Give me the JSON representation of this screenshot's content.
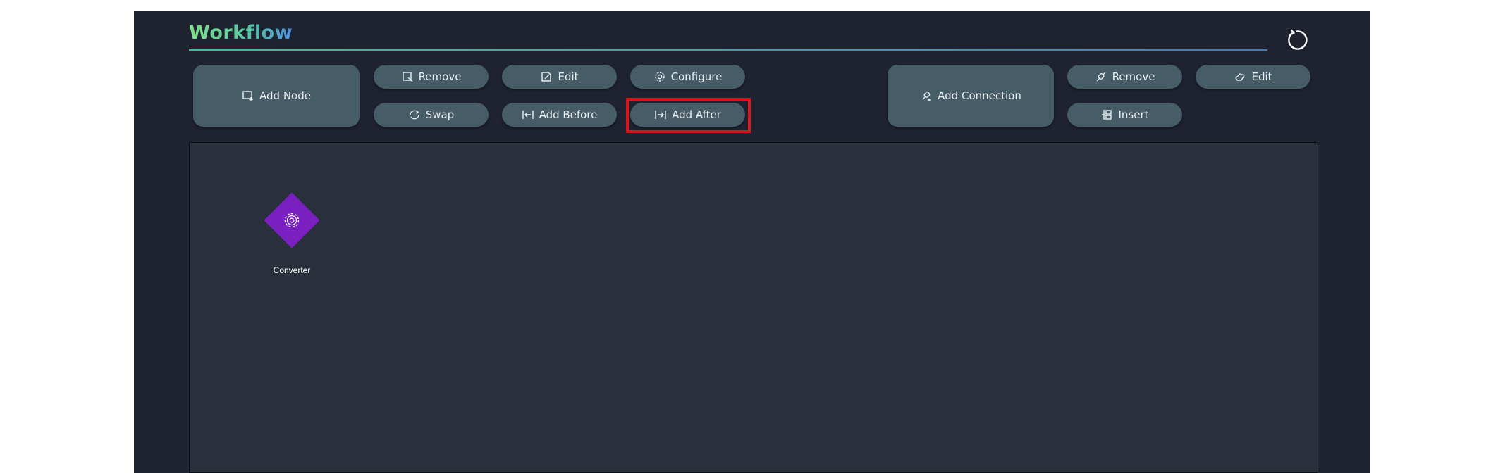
{
  "header": {
    "title": "Workflow",
    "refresh_icon": "refresh-icon"
  },
  "node_toolbar": {
    "add_node": {
      "label": "Add Node",
      "icon": "add-node-icon"
    },
    "remove": {
      "label": "Remove",
      "icon": "remove-icon"
    },
    "edit": {
      "label": "Edit",
      "icon": "edit-icon"
    },
    "configure": {
      "label": "Configure",
      "icon": "gear-icon"
    },
    "swap": {
      "label": "Swap",
      "icon": "swap-icon"
    },
    "add_before": {
      "label": "Add Before",
      "icon": "add-before-icon"
    },
    "add_after": {
      "label": "Add After",
      "icon": "add-after-icon",
      "highlighted": true
    }
  },
  "connection_toolbar": {
    "add_connection": {
      "label": "Add Connection",
      "icon": "add-connection-icon"
    },
    "remove": {
      "label": "Remove",
      "icon": "remove-connection-icon"
    },
    "edit": {
      "label": "Edit",
      "icon": "edit-connection-icon"
    },
    "insert": {
      "label": "Insert",
      "icon": "insert-icon"
    }
  },
  "canvas": {
    "nodes": [
      {
        "label": "Converter",
        "shape": "diamond",
        "color": "#7a1fc0",
        "icon": "converter-gear-icon"
      }
    ]
  },
  "colors": {
    "app_background": "#1f2330",
    "canvas_background": "#2a2f3c",
    "button_background": "#465d68",
    "highlight": "#d9141b"
  }
}
